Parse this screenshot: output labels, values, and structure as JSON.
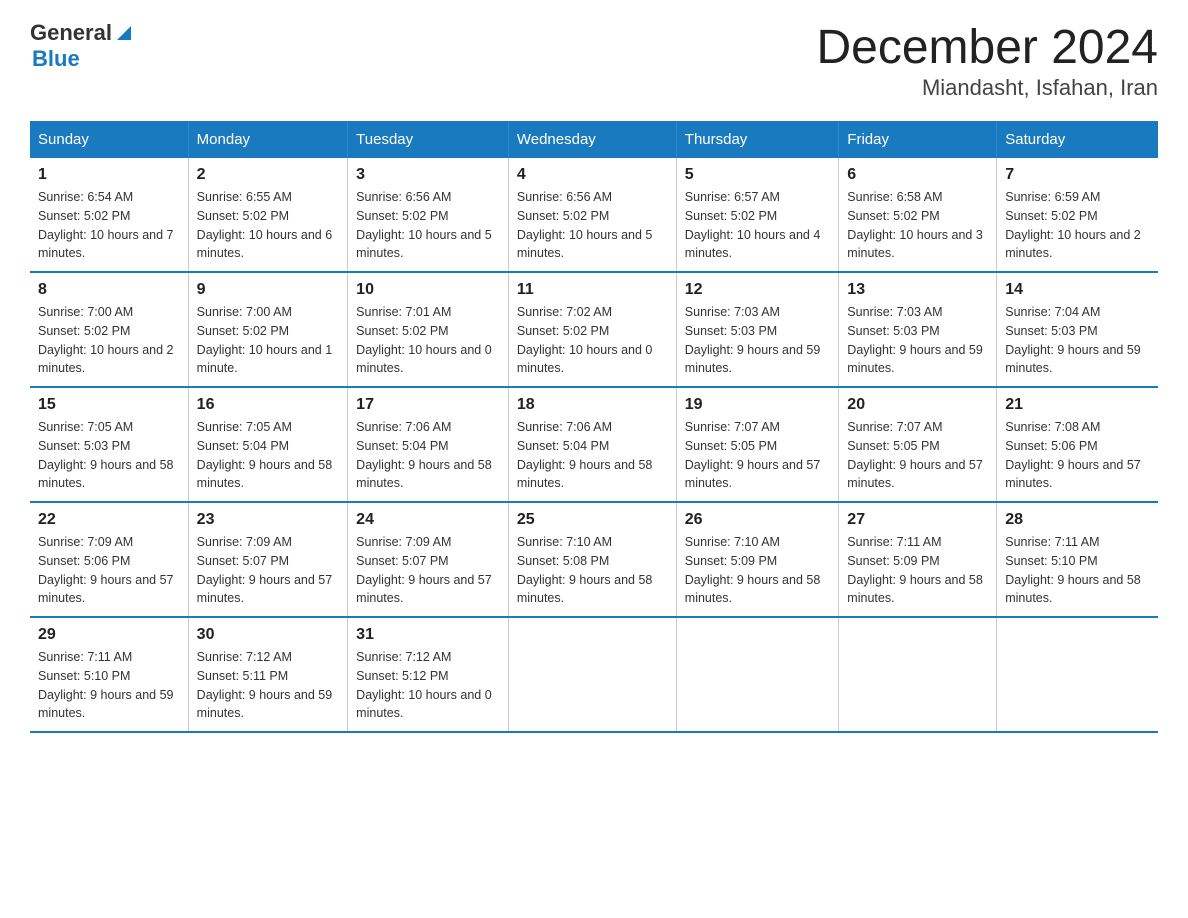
{
  "header": {
    "logo_general": "General",
    "logo_blue": "Blue",
    "title": "December 2024",
    "subtitle": "Miandasht, Isfahan, Iran"
  },
  "days_of_week": [
    "Sunday",
    "Monday",
    "Tuesday",
    "Wednesday",
    "Thursday",
    "Friday",
    "Saturday"
  ],
  "weeks": [
    [
      {
        "day": "1",
        "sunrise": "6:54 AM",
        "sunset": "5:02 PM",
        "daylight": "10 hours and 7 minutes."
      },
      {
        "day": "2",
        "sunrise": "6:55 AM",
        "sunset": "5:02 PM",
        "daylight": "10 hours and 6 minutes."
      },
      {
        "day": "3",
        "sunrise": "6:56 AM",
        "sunset": "5:02 PM",
        "daylight": "10 hours and 5 minutes."
      },
      {
        "day": "4",
        "sunrise": "6:56 AM",
        "sunset": "5:02 PM",
        "daylight": "10 hours and 5 minutes."
      },
      {
        "day": "5",
        "sunrise": "6:57 AM",
        "sunset": "5:02 PM",
        "daylight": "10 hours and 4 minutes."
      },
      {
        "day": "6",
        "sunrise": "6:58 AM",
        "sunset": "5:02 PM",
        "daylight": "10 hours and 3 minutes."
      },
      {
        "day": "7",
        "sunrise": "6:59 AM",
        "sunset": "5:02 PM",
        "daylight": "10 hours and 2 minutes."
      }
    ],
    [
      {
        "day": "8",
        "sunrise": "7:00 AM",
        "sunset": "5:02 PM",
        "daylight": "10 hours and 2 minutes."
      },
      {
        "day": "9",
        "sunrise": "7:00 AM",
        "sunset": "5:02 PM",
        "daylight": "10 hours and 1 minute."
      },
      {
        "day": "10",
        "sunrise": "7:01 AM",
        "sunset": "5:02 PM",
        "daylight": "10 hours and 0 minutes."
      },
      {
        "day": "11",
        "sunrise": "7:02 AM",
        "sunset": "5:02 PM",
        "daylight": "10 hours and 0 minutes."
      },
      {
        "day": "12",
        "sunrise": "7:03 AM",
        "sunset": "5:03 PM",
        "daylight": "9 hours and 59 minutes."
      },
      {
        "day": "13",
        "sunrise": "7:03 AM",
        "sunset": "5:03 PM",
        "daylight": "9 hours and 59 minutes."
      },
      {
        "day": "14",
        "sunrise": "7:04 AM",
        "sunset": "5:03 PM",
        "daylight": "9 hours and 59 minutes."
      }
    ],
    [
      {
        "day": "15",
        "sunrise": "7:05 AM",
        "sunset": "5:03 PM",
        "daylight": "9 hours and 58 minutes."
      },
      {
        "day": "16",
        "sunrise": "7:05 AM",
        "sunset": "5:04 PM",
        "daylight": "9 hours and 58 minutes."
      },
      {
        "day": "17",
        "sunrise": "7:06 AM",
        "sunset": "5:04 PM",
        "daylight": "9 hours and 58 minutes."
      },
      {
        "day": "18",
        "sunrise": "7:06 AM",
        "sunset": "5:04 PM",
        "daylight": "9 hours and 58 minutes."
      },
      {
        "day": "19",
        "sunrise": "7:07 AM",
        "sunset": "5:05 PM",
        "daylight": "9 hours and 57 minutes."
      },
      {
        "day": "20",
        "sunrise": "7:07 AM",
        "sunset": "5:05 PM",
        "daylight": "9 hours and 57 minutes."
      },
      {
        "day": "21",
        "sunrise": "7:08 AM",
        "sunset": "5:06 PM",
        "daylight": "9 hours and 57 minutes."
      }
    ],
    [
      {
        "day": "22",
        "sunrise": "7:09 AM",
        "sunset": "5:06 PM",
        "daylight": "9 hours and 57 minutes."
      },
      {
        "day": "23",
        "sunrise": "7:09 AM",
        "sunset": "5:07 PM",
        "daylight": "9 hours and 57 minutes."
      },
      {
        "day": "24",
        "sunrise": "7:09 AM",
        "sunset": "5:07 PM",
        "daylight": "9 hours and 57 minutes."
      },
      {
        "day": "25",
        "sunrise": "7:10 AM",
        "sunset": "5:08 PM",
        "daylight": "9 hours and 58 minutes."
      },
      {
        "day": "26",
        "sunrise": "7:10 AM",
        "sunset": "5:09 PM",
        "daylight": "9 hours and 58 minutes."
      },
      {
        "day": "27",
        "sunrise": "7:11 AM",
        "sunset": "5:09 PM",
        "daylight": "9 hours and 58 minutes."
      },
      {
        "day": "28",
        "sunrise": "7:11 AM",
        "sunset": "5:10 PM",
        "daylight": "9 hours and 58 minutes."
      }
    ],
    [
      {
        "day": "29",
        "sunrise": "7:11 AM",
        "sunset": "5:10 PM",
        "daylight": "9 hours and 59 minutes."
      },
      {
        "day": "30",
        "sunrise": "7:12 AM",
        "sunset": "5:11 PM",
        "daylight": "9 hours and 59 minutes."
      },
      {
        "day": "31",
        "sunrise": "7:12 AM",
        "sunset": "5:12 PM",
        "daylight": "10 hours and 0 minutes."
      },
      {
        "day": "",
        "sunrise": "",
        "sunset": "",
        "daylight": ""
      },
      {
        "day": "",
        "sunrise": "",
        "sunset": "",
        "daylight": ""
      },
      {
        "day": "",
        "sunrise": "",
        "sunset": "",
        "daylight": ""
      },
      {
        "day": "",
        "sunrise": "",
        "sunset": "",
        "daylight": ""
      }
    ]
  ]
}
